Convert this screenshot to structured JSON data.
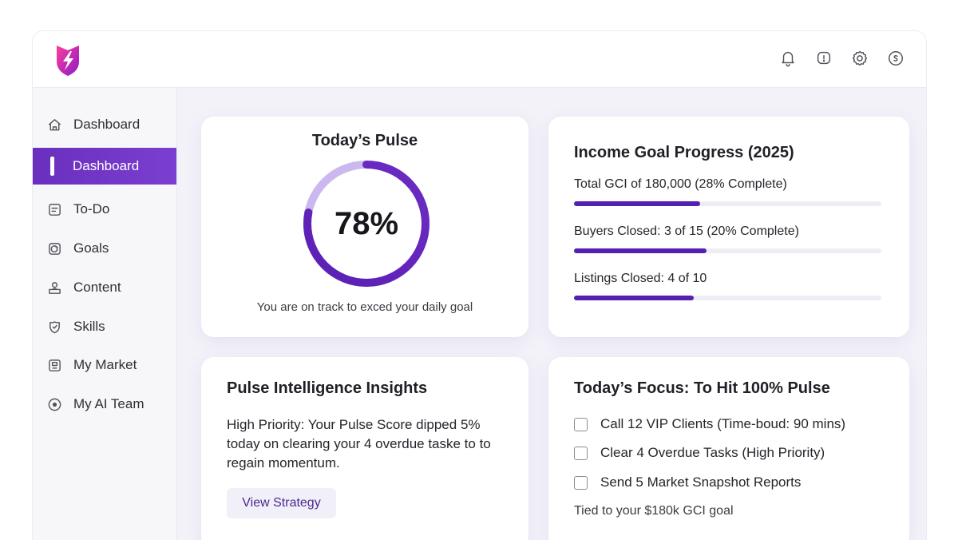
{
  "brand": {
    "primary": "#6a2fbe",
    "logo": "lightning-shield-logo"
  },
  "header": {
    "icons": [
      "bell-icon",
      "alert-icon",
      "gear-icon",
      "coin-icon"
    ]
  },
  "sidebar": {
    "items": [
      {
        "label": "Dashboard",
        "icon": "home-icon",
        "active": false
      },
      {
        "label": "Dashboard",
        "icon": "active-indicator",
        "active": true
      },
      {
        "label": "To-Do",
        "icon": "list-icon",
        "active": false
      },
      {
        "label": "Goals",
        "icon": "goal-icon",
        "active": false
      },
      {
        "label": "Content",
        "icon": "content-icon",
        "active": false
      },
      {
        "label": "Skills",
        "icon": "skills-icon",
        "active": false
      },
      {
        "label": "My Market",
        "icon": "market-icon",
        "active": false
      },
      {
        "label": "My AI Team",
        "icon": "ai-team-icon",
        "active": false
      }
    ]
  },
  "pulse": {
    "title": "Today’s Pulse",
    "value": "78%",
    "percent": 78,
    "caption": "You are on track to exced your daily goal"
  },
  "income": {
    "title": "Income Goal Progress (2025)",
    "rows": [
      {
        "label": "Total GCI of 180,000",
        "detail": " (28% Complete)",
        "progress": 0.41
      },
      {
        "label": "Buyers Closed",
        "detail": ": 3 of 15 (20% Complete)",
        "progress": 0.43
      },
      {
        "label": "Listings Closed",
        "detail": ": 4 of 10",
        "progress": 0.39
      }
    ]
  },
  "insights": {
    "title": "Pulse Intelligence Insights",
    "body": "High Priority: Your Pulse Score dipped 5% today on clearing your 4 overdue taske to to regain momentum.",
    "button": "View Strategy"
  },
  "focus": {
    "title": "Today’s Focus: To Hit 100% Pulse",
    "items": [
      "Call 12 VIP Clients (Time-boud: 90 mins)",
      "Clear 4 Overdue Tasks (High Priority)",
      "Send 5 Market Snapshot Reports"
    ],
    "note": "Tied to your $180k GCI goal"
  }
}
